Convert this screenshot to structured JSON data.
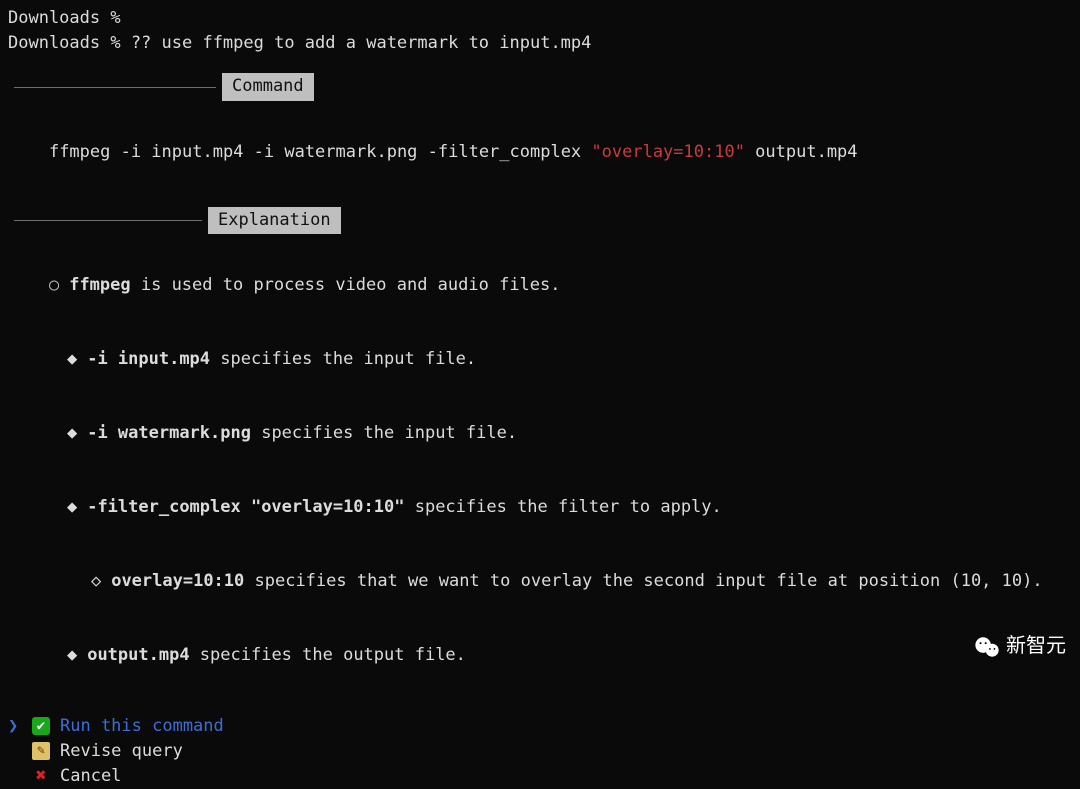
{
  "prompt": {
    "line1": "Downloads %",
    "line2": "Downloads % ?? use ffmpeg to add a watermark to input.mp4"
  },
  "sections": {
    "command_label": "Command",
    "explanation_label": "Explanation"
  },
  "command": {
    "p1": "ffmpeg -i input.mp4 -i watermark.png -filter_complex ",
    "quoted": "\"overlay=10:10\"",
    "p2": " output.mp4"
  },
  "explanation": {
    "root": {
      "bullet": "○",
      "term": "ffmpeg",
      "rest": " is used to process video and audio files."
    },
    "items": [
      {
        "bullet": "◆",
        "term": "-i input.mp4",
        "rest": " specifies the input file."
      },
      {
        "bullet": "◆",
        "term": "-i watermark.png",
        "rest": " specifies the input file."
      },
      {
        "bullet": "◆",
        "term": "-filter_complex \"overlay=10:10\"",
        "rest": " specifies the filter to apply."
      },
      {
        "bullet": "◆",
        "term": "output.mp4",
        "rest": " specifies the output file."
      }
    ],
    "subitem": {
      "bullet": "◇",
      "term": "overlay=10:10",
      "rest": " specifies that we want to overlay the second input file at position (10, 10)."
    }
  },
  "options": {
    "arrow": "❯",
    "run": {
      "icon": "✔",
      "label": "Run this command"
    },
    "revise": {
      "icon": "✎",
      "label": "Revise query"
    },
    "cancel": {
      "icon": "✖",
      "label": "Cancel"
    }
  },
  "watermark": "新智元"
}
